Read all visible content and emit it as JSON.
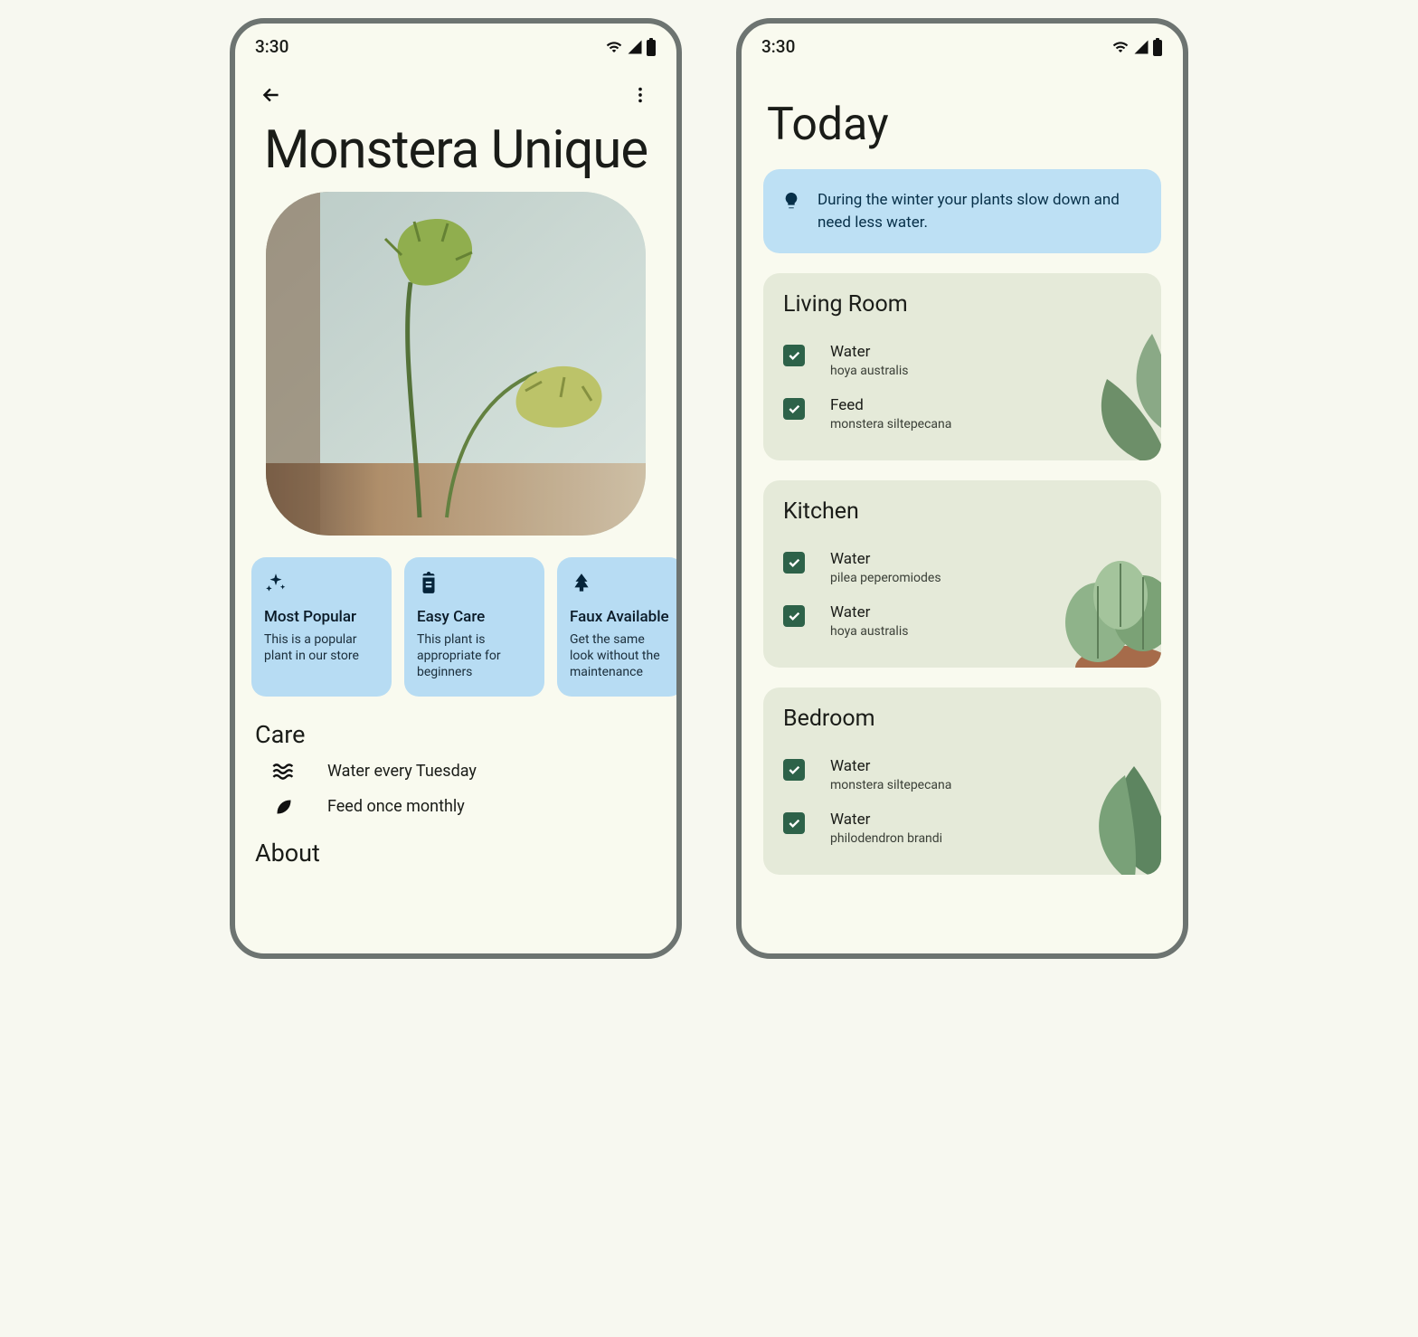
{
  "status": {
    "time": "3:30"
  },
  "left": {
    "title": "Monstera Unique",
    "chips": [
      {
        "title": "Most Popular",
        "desc": "This is a popular plant in our store"
      },
      {
        "title": "Easy Care",
        "desc": "This plant is appropriate for beginners"
      },
      {
        "title": "Faux Available",
        "desc": "Get the same look without the maintenance"
      }
    ],
    "care_heading": "Care",
    "care": [
      "Water every Tuesday",
      "Feed once monthly"
    ],
    "about_heading": "About"
  },
  "right": {
    "title": "Today",
    "tip": "During the winter your plants slow down and need less water.",
    "rooms": [
      {
        "name": "Living Room",
        "tasks": [
          {
            "action": "Water",
            "plant": "hoya australis"
          },
          {
            "action": "Feed",
            "plant": "monstera siltepecana"
          }
        ]
      },
      {
        "name": "Kitchen",
        "tasks": [
          {
            "action": "Water",
            "plant": "pilea peperomiodes"
          },
          {
            "action": "Water",
            "plant": "hoya australis"
          }
        ]
      },
      {
        "name": "Bedroom",
        "tasks": [
          {
            "action": "Water",
            "plant": "monstera siltepecana"
          },
          {
            "action": "Water",
            "plant": "philodendron brandi"
          }
        ]
      }
    ]
  }
}
